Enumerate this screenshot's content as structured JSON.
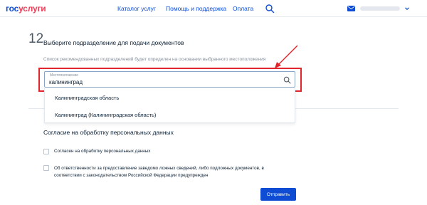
{
  "header": {
    "logo_part1": "гос",
    "logo_part2": "услуги",
    "nav": {
      "catalog": "Каталог услуг",
      "help": "Помощь и поддержка",
      "payment": "Оплата"
    },
    "icons": [
      "search-icon",
      "mail-icon",
      "chevron-down-icon"
    ]
  },
  "step": {
    "number": "12",
    "title": "Выберите подразделение для подачи документов",
    "hint": "Список рекомендованных подразделений будет определен на основании выбранного местоположения"
  },
  "location": {
    "label": "Местоположение",
    "value": "калининград",
    "suggestions": [
      "Калининградская область",
      "Калининград (Калининградская область)"
    ]
  },
  "consent": {
    "title": "Согласие на обработку персональных данных",
    "checkbox1": "Согласен на обработку персональных данных",
    "checkbox2": "Об ответственности за предоставление заведомо ложных сведений, либо подложных документов, в соответствии с законодательством Российской Федерации предупрежден"
  },
  "submit_label": "Отправить",
  "colors": {
    "brand_blue": "#0d4cd3",
    "brand_red": "#ee3f58",
    "annotation_red": "#e0262c"
  }
}
